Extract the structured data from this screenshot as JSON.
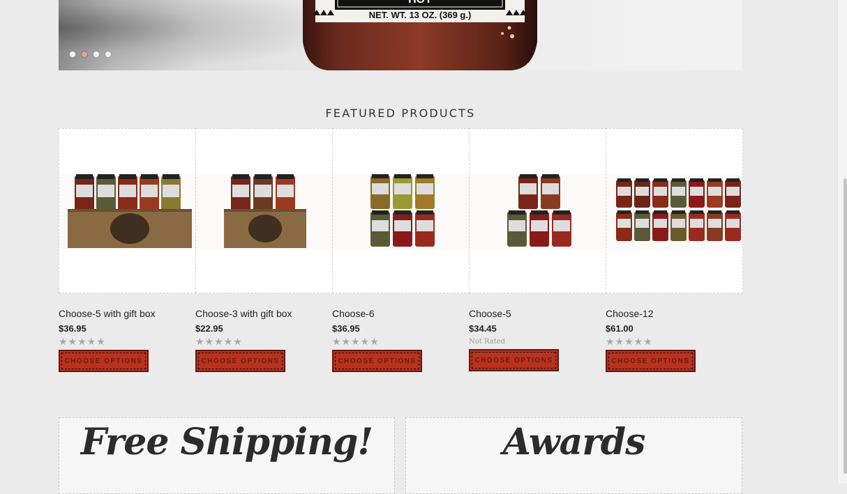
{
  "hero": {
    "label_text": "HOT",
    "net_weight": "NET. WT. 13 OZ. (369 g.)",
    "slide_count": 4,
    "active_slide": 2
  },
  "featured": {
    "title": "FEATURED PRODUCTS",
    "products": [
      {
        "name": "Choose-5 with gift box",
        "price": "$36.95",
        "rating": "",
        "button": "CHOOSE OPTIONS"
      },
      {
        "name": "Choose-3 with gift box",
        "price": "$22.95",
        "rating": "",
        "button": "CHOOSE OPTIONS"
      },
      {
        "name": "Choose-6",
        "price": "$36.95",
        "rating": "",
        "button": "CHOOSE OPTIONS"
      },
      {
        "name": "Choose-5",
        "price": "$34.45",
        "rating": "Not Rated",
        "button": "CHOOSE OPTIONS"
      },
      {
        "name": "Choose-12",
        "price": "$61.00",
        "rating": "",
        "button": "CHOOSE OPTIONS"
      }
    ]
  },
  "promos": {
    "left_title": "Free Shipping!",
    "right_title": "Awards"
  },
  "colors": {
    "page_bg": "#ebebeb",
    "button_red": "#b8321f",
    "button_border": "#6b1408"
  }
}
